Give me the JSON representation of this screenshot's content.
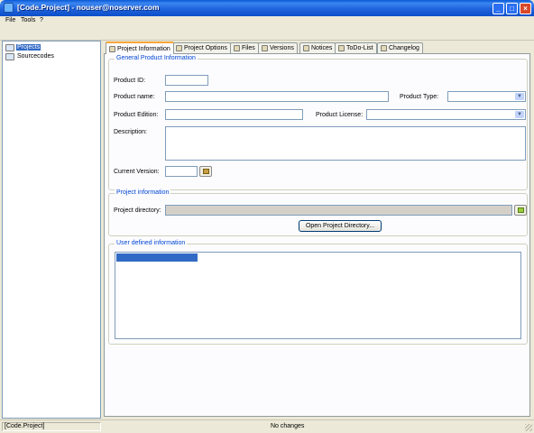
{
  "window": {
    "title": "[Code.Project] - nouser@noserver.com",
    "controls": {
      "minimize": "_",
      "maximize": "□",
      "close": "×"
    }
  },
  "menu": {
    "items": [
      "File",
      "Tools",
      "?"
    ]
  },
  "tree": {
    "items": [
      {
        "label": "Projects",
        "icon": "projects-icon",
        "selected": true
      },
      {
        "label": "Sourcecodes",
        "icon": "sourcecodes-icon",
        "selected": false
      }
    ]
  },
  "tabs": [
    {
      "label": "Project Information",
      "icon": "info-icon",
      "active": true
    },
    {
      "label": "Project Options",
      "icon": "options-icon",
      "active": false
    },
    {
      "label": "Files",
      "icon": "files-icon",
      "active": false
    },
    {
      "label": "Versions",
      "icon": "versions-icon",
      "active": false
    },
    {
      "label": "Notices",
      "icon": "notices-icon",
      "active": false
    },
    {
      "label": "ToDo-List",
      "icon": "todo-icon",
      "active": false
    },
    {
      "label": "Changelog",
      "icon": "changelog-icon",
      "active": false
    }
  ],
  "general": {
    "title": "General Product Information",
    "product_id_label": "Product ID:",
    "product_id_value": "",
    "product_name_label": "Product name:",
    "product_name_value": "",
    "product_type_label": "Product Type:",
    "product_type_value": "",
    "product_edition_label": "Product Edition:",
    "product_edition_value": "",
    "product_license_label": "Product License:",
    "product_license_value": "",
    "description_label": "Description:",
    "description_value": "",
    "current_version_label": "Current Version:",
    "current_version_value": ""
  },
  "project": {
    "title": "Project information",
    "directory_label": "Project directory:",
    "directory_value": "",
    "open_button": "Open Project Directory..."
  },
  "user_defined": {
    "title": "User defined information"
  },
  "status": {
    "left": "[Code.Project]",
    "middle": "No changes"
  },
  "colors": {
    "title_bar": "#0a58d6",
    "selection": "#316ac5",
    "group_title": "#0046d5",
    "active_tab_accent": "#f7a63a"
  }
}
